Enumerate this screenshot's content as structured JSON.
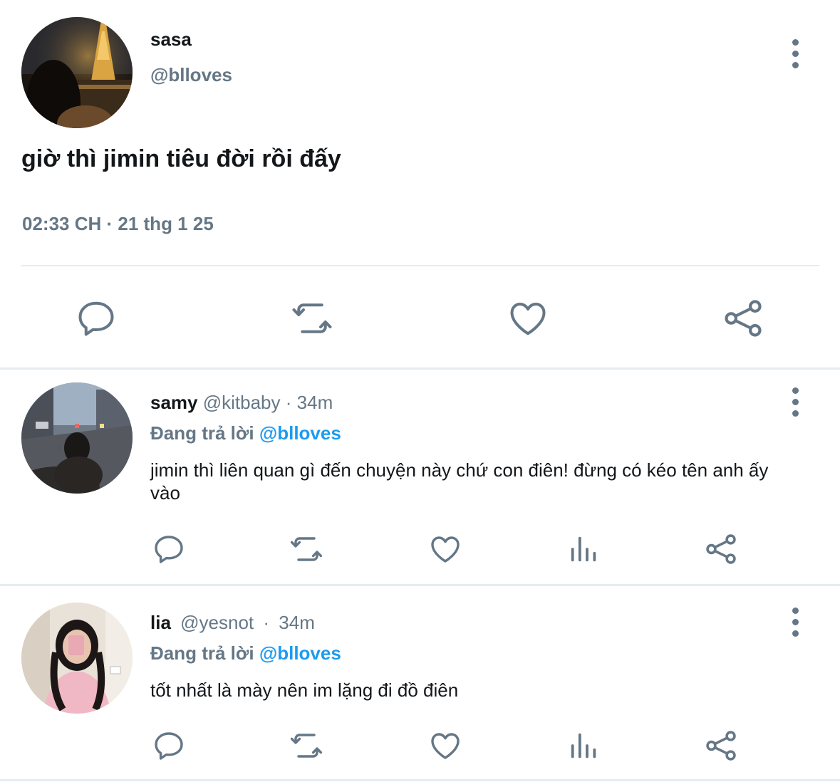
{
  "main_tweet": {
    "name": "sasa",
    "handle": "@blloves",
    "text": "giờ thì jimin tiêu đời rồi đấy",
    "timestamp": "02:33 CH · 21 thg 1 25",
    "avatar": "eiffel-tower-night-photo",
    "actions": [
      "reply-icon",
      "retweet-icon",
      "like-icon",
      "share-icon"
    ]
  },
  "replies": [
    {
      "name": "samy",
      "handle": "@kitbaby",
      "sep": "·",
      "time": "34m",
      "replying_prefix": "Đang trả lời",
      "replying_to": "@blloves",
      "text": "jimin thì liên quan gì đến chuyện này chứ con điên! đừng có kéo tên anh ấy vào",
      "avatar": "city-street-photo"
    },
    {
      "name": "lia",
      "handle": "@yesnot",
      "sep": "·",
      "time": "34m",
      "replying_prefix": "Đang trả lời",
      "replying_to": "@blloves",
      "text": "tốt nhất là mày nên im lặng đi đồ điên",
      "avatar": "mirror-selfie-photo"
    }
  ],
  "colors": {
    "text": "#14171a",
    "secondary": "#657786",
    "link": "#1d9bf0",
    "divider": "#e6ecf0"
  }
}
